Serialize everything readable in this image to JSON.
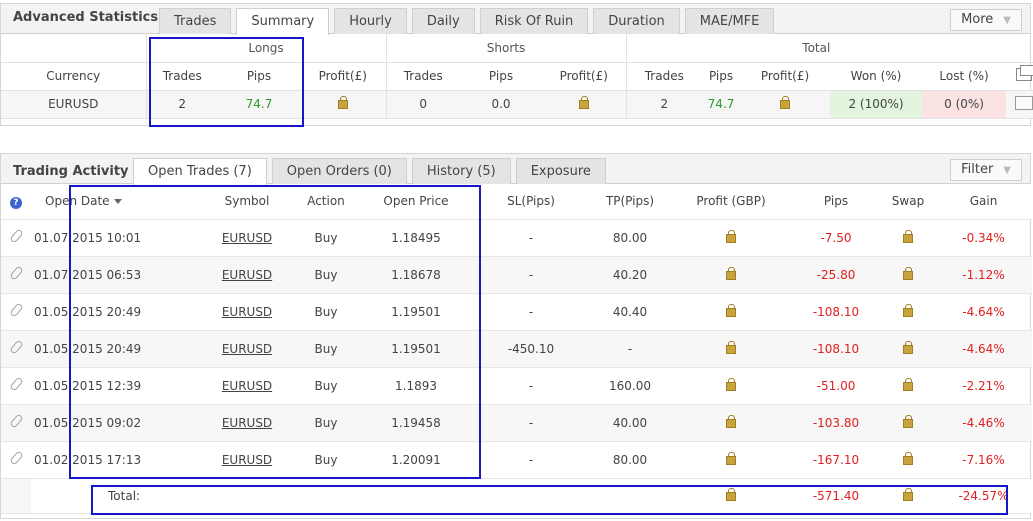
{
  "advanced": {
    "title": "Advanced Statistics",
    "tabs": [
      "Trades",
      "Summary",
      "Hourly",
      "Daily",
      "Risk Of Ruin",
      "Duration",
      "MAE/MFE"
    ],
    "more_label": "More",
    "groups": {
      "longs": "Longs",
      "shorts": "Shorts",
      "total": "Total"
    },
    "headers": {
      "currency": "Currency",
      "trades": "Trades",
      "pips": "Pips",
      "profit": "Profit(£)",
      "won": "Won (%)",
      "lost": "Lost (%)"
    },
    "row": {
      "currency": "EURUSD",
      "long_trades": "2",
      "long_pips": "74.7",
      "short_trades": "0",
      "short_pips": "0.0",
      "total_trades": "2",
      "total_pips": "74.7",
      "won": "2 (100%)",
      "lost": "0 (0%)"
    }
  },
  "activity": {
    "title": "Trading Activity",
    "tabs": [
      "Open Trades (7)",
      "Open Orders (0)",
      "History (5)",
      "Exposure"
    ],
    "filter_label": "Filter",
    "headers": {
      "open_date": "Open Date",
      "symbol": "Symbol",
      "action": "Action",
      "open_price": "Open Price",
      "sl": "SL(Pips)",
      "tp": "TP(Pips)",
      "profit": "Profit (GBP)",
      "pips": "Pips",
      "swap": "Swap",
      "gain": "Gain"
    },
    "rows": [
      {
        "date": "01.07.2015 10:01",
        "symbol": "EURUSD",
        "action": "Buy",
        "price": "1.18495",
        "sl": "-",
        "tp": "80.00",
        "pips": "-7.50",
        "gain": "-0.34%"
      },
      {
        "date": "01.07.2015 06:53",
        "symbol": "EURUSD",
        "action": "Buy",
        "price": "1.18678",
        "sl": "-",
        "tp": "40.20",
        "pips": "-25.80",
        "gain": "-1.12%"
      },
      {
        "date": "01.05.2015 20:49",
        "symbol": "EURUSD",
        "action": "Buy",
        "price": "1.19501",
        "sl": "-",
        "tp": "40.40",
        "pips": "-108.10",
        "gain": "-4.64%"
      },
      {
        "date": "01.05.2015 20:49",
        "symbol": "EURUSD",
        "action": "Buy",
        "price": "1.19501",
        "sl": "-450.10",
        "tp": "-",
        "pips": "-108.10",
        "gain": "-4.64%"
      },
      {
        "date": "01.05.2015 12:39",
        "symbol": "EURUSD",
        "action": "Buy",
        "price": "1.1893",
        "sl": "-",
        "tp": "160.00",
        "pips": "-51.00",
        "gain": "-2.21%"
      },
      {
        "date": "01.05.2015 09:02",
        "symbol": "EURUSD",
        "action": "Buy",
        "price": "1.19458",
        "sl": "-",
        "tp": "40.00",
        "pips": "-103.80",
        "gain": "-4.46%"
      },
      {
        "date": "01.02.2015 17:13",
        "symbol": "EURUSD",
        "action": "Buy",
        "price": "1.20091",
        "sl": "-",
        "tp": "80.00",
        "pips": "-167.10",
        "gain": "-7.16%"
      }
    ],
    "total": {
      "label": "Total:",
      "pips": "-571.40",
      "gain": "-24.57%"
    }
  },
  "colors": {
    "positive": "#2d9a2d",
    "negative": "#e02020",
    "highlight_box": "#1717c7"
  },
  "icons": {
    "profit": "lock-icon",
    "row": "paperclip-icon",
    "help": "help-icon",
    "columns": "window-icon",
    "chart": "chart-icon"
  }
}
